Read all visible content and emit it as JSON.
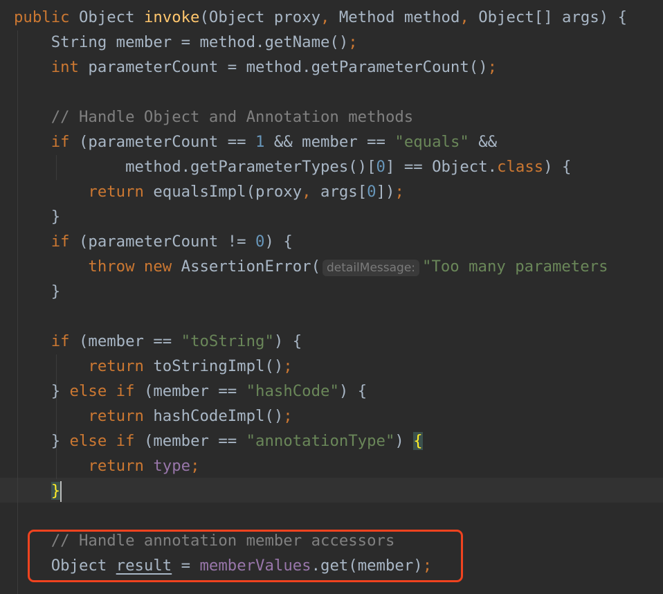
{
  "editor": {
    "colors": {
      "background": "#2b2b2b",
      "keyword": "#cc7832",
      "method_declaration": "#ffc66d",
      "text": "#a9b7c6",
      "string": "#6a8759",
      "number": "#6897bb",
      "comment": "#808080",
      "field": "#9876aa",
      "highlight_box": "#f0431f"
    },
    "current_line": 19,
    "highlighted_lines": [
      21,
      22
    ],
    "lines": [
      [
        [
          "k",
          "public "
        ],
        [
          "d",
          "Object "
        ],
        [
          "m",
          "invoke"
        ],
        [
          "d",
          "(Object proxy"
        ],
        [
          "p",
          ", "
        ],
        [
          "d",
          "Method method"
        ],
        [
          "p",
          ", "
        ],
        [
          "d",
          "Object[] args) {"
        ]
      ],
      [
        [
          "d",
          "    String member = method.getName()"
        ],
        [
          "p",
          ";"
        ]
      ],
      [
        [
          "k",
          "    int "
        ],
        [
          "d",
          "parameterCount = method.getParameterCount()"
        ],
        [
          "p",
          ";"
        ]
      ],
      [],
      [
        [
          "c",
          "    // Handle Object and Annotation methods"
        ]
      ],
      [
        [
          "k",
          "    if "
        ],
        [
          "d",
          "(parameterCount == "
        ],
        [
          "n",
          "1"
        ],
        [
          "d",
          " && member == "
        ],
        [
          "s",
          "\"equals\""
        ],
        [
          "d",
          " &&"
        ]
      ],
      [
        [
          "d",
          "            method.getParameterTypes()["
        ],
        [
          "n",
          "0"
        ],
        [
          "d",
          "] == Object."
        ],
        [
          "k",
          "class"
        ],
        [
          "d",
          ") {"
        ]
      ],
      [
        [
          "k",
          "        return "
        ],
        [
          "d",
          "equalsImpl(proxy"
        ],
        [
          "p",
          ", "
        ],
        [
          "d",
          "args["
        ],
        [
          "n",
          "0"
        ],
        [
          "d",
          "])"
        ],
        [
          "p",
          ";"
        ]
      ],
      [
        [
          "d",
          "    }"
        ]
      ],
      [
        [
          "k",
          "    if "
        ],
        [
          "d",
          "(parameterCount != "
        ],
        [
          "n",
          "0"
        ],
        [
          "d",
          ") {"
        ]
      ],
      [
        [
          "k",
          "        throw new "
        ],
        [
          "d",
          "AssertionError("
        ],
        [
          "h",
          "detailMessage:"
        ],
        [
          "s",
          "\"Too many parameters"
        ]
      ],
      [
        [
          "d",
          "    }"
        ]
      ],
      [],
      [
        [
          "k",
          "    if "
        ],
        [
          "d",
          "(member == "
        ],
        [
          "s",
          "\"toString\""
        ],
        [
          "d",
          ") {"
        ]
      ],
      [
        [
          "k",
          "        return "
        ],
        [
          "d",
          "toStringImpl()"
        ],
        [
          "p",
          ";"
        ]
      ],
      [
        [
          "d",
          "    } "
        ],
        [
          "k",
          "else if "
        ],
        [
          "d",
          "(member == "
        ],
        [
          "s",
          "\"hashCode\""
        ],
        [
          "d",
          ") {"
        ]
      ],
      [
        [
          "k",
          "        return "
        ],
        [
          "d",
          "hashCodeImpl()"
        ],
        [
          "p",
          ";"
        ]
      ],
      [
        [
          "d",
          "    } "
        ],
        [
          "k",
          "else if "
        ],
        [
          "d",
          "(member == "
        ],
        [
          "s",
          "\"annotationType\""
        ],
        [
          "d",
          ") "
        ],
        [
          "b",
          "{"
        ]
      ],
      [
        [
          "k",
          "        return "
        ],
        [
          "f",
          "type"
        ],
        [
          "p",
          ";"
        ]
      ],
      [
        [
          "d",
          "    "
        ],
        [
          "b",
          "}"
        ],
        [
          "caret",
          ""
        ]
      ],
      [],
      [
        [
          "c",
          "    // Handle annotation member accessors"
        ]
      ],
      [
        [
          "d",
          "    Object "
        ],
        [
          "u",
          "result"
        ],
        [
          "d",
          " = "
        ],
        [
          "f",
          "memberValues"
        ],
        [
          "d",
          ".get(member)"
        ],
        [
          "p",
          ";"
        ]
      ]
    ]
  }
}
